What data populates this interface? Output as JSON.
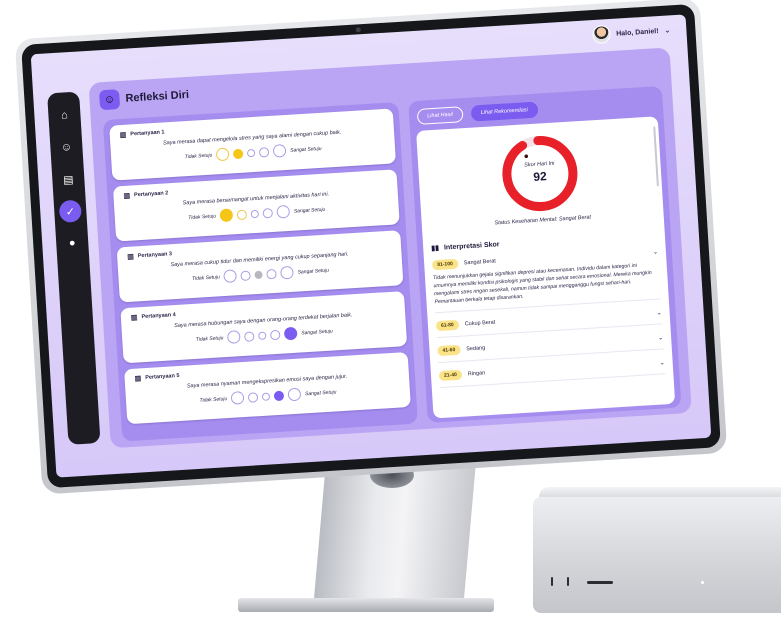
{
  "user": {
    "greeting": "Halo, Daniel!"
  },
  "sidebar": {
    "items": [
      "home",
      "mood",
      "journal",
      "refleksi",
      "tips"
    ]
  },
  "page": {
    "title": "Refleksi Diri"
  },
  "scale": {
    "min_label": "Tidak Setuju",
    "max_label": "Sangat Setuju"
  },
  "questions": [
    {
      "label": "Pertanyaan 1",
      "text": "Saya merasa dapat mengelola stres yang saya alami dengan cukup baik.",
      "selected": 2,
      "scale_color": "yellow"
    },
    {
      "label": "Pertanyaan 2",
      "text": "Saya merasa bersemangat untuk menjalani aktivitas hari ini.",
      "selected": 1,
      "scale_color": "yellow"
    },
    {
      "label": "Pertanyaan 3",
      "text": "Saya merasa cukup tidur dan memiliki energi yang cukup sepanjang hari.",
      "selected": 3,
      "scale_color": "gray"
    },
    {
      "label": "Pertanyaan 4",
      "text": "Saya merasa hubungan saya dengan orang-orang terdekat berjalan baik.",
      "selected": 5,
      "scale_color": "purple"
    },
    {
      "label": "Pertanyaan 5",
      "text": "Saya merasa nyaman mengekspresikan emosi saya dengan jujur.",
      "selected": 4,
      "scale_color": "purple"
    }
  ],
  "tabs": {
    "hasil": "Lihat Hasil",
    "rekomendasi": "Lihat Rekomendasi"
  },
  "gauge": {
    "label": "Skor Hari Ini",
    "value": "92",
    "fraction": 0.92,
    "color": "#e8202a"
  },
  "status": "Status Kesehatan Mental: Sangat Berat",
  "interpretation": {
    "title": "Interpretasi Skor",
    "ranges": [
      {
        "range": "81-100",
        "label": "Sangat Berat",
        "description": "Tidak menunjukkan gejala signifikan depresi atau kecemasan. Individu dalam kategori ini umumnya memiliki kondisi psikologis yang stabil dan sehat secara emosional. Mereka mungkin mengalami stres ringan sesekali, namun tidak sampai mengganggu fungsi sehari-hari. Pemantauan berkala tetap disarankan."
      },
      {
        "range": "61-80",
        "label": "Cukup Berat",
        "description": ""
      },
      {
        "range": "41-60",
        "label": "Sedang",
        "description": ""
      },
      {
        "range": "21-40",
        "label": "Ringan",
        "description": ""
      }
    ]
  },
  "colors": {
    "accent": "#7b5cf0",
    "panel": "#a58df0",
    "badge": "#fbe38a"
  }
}
